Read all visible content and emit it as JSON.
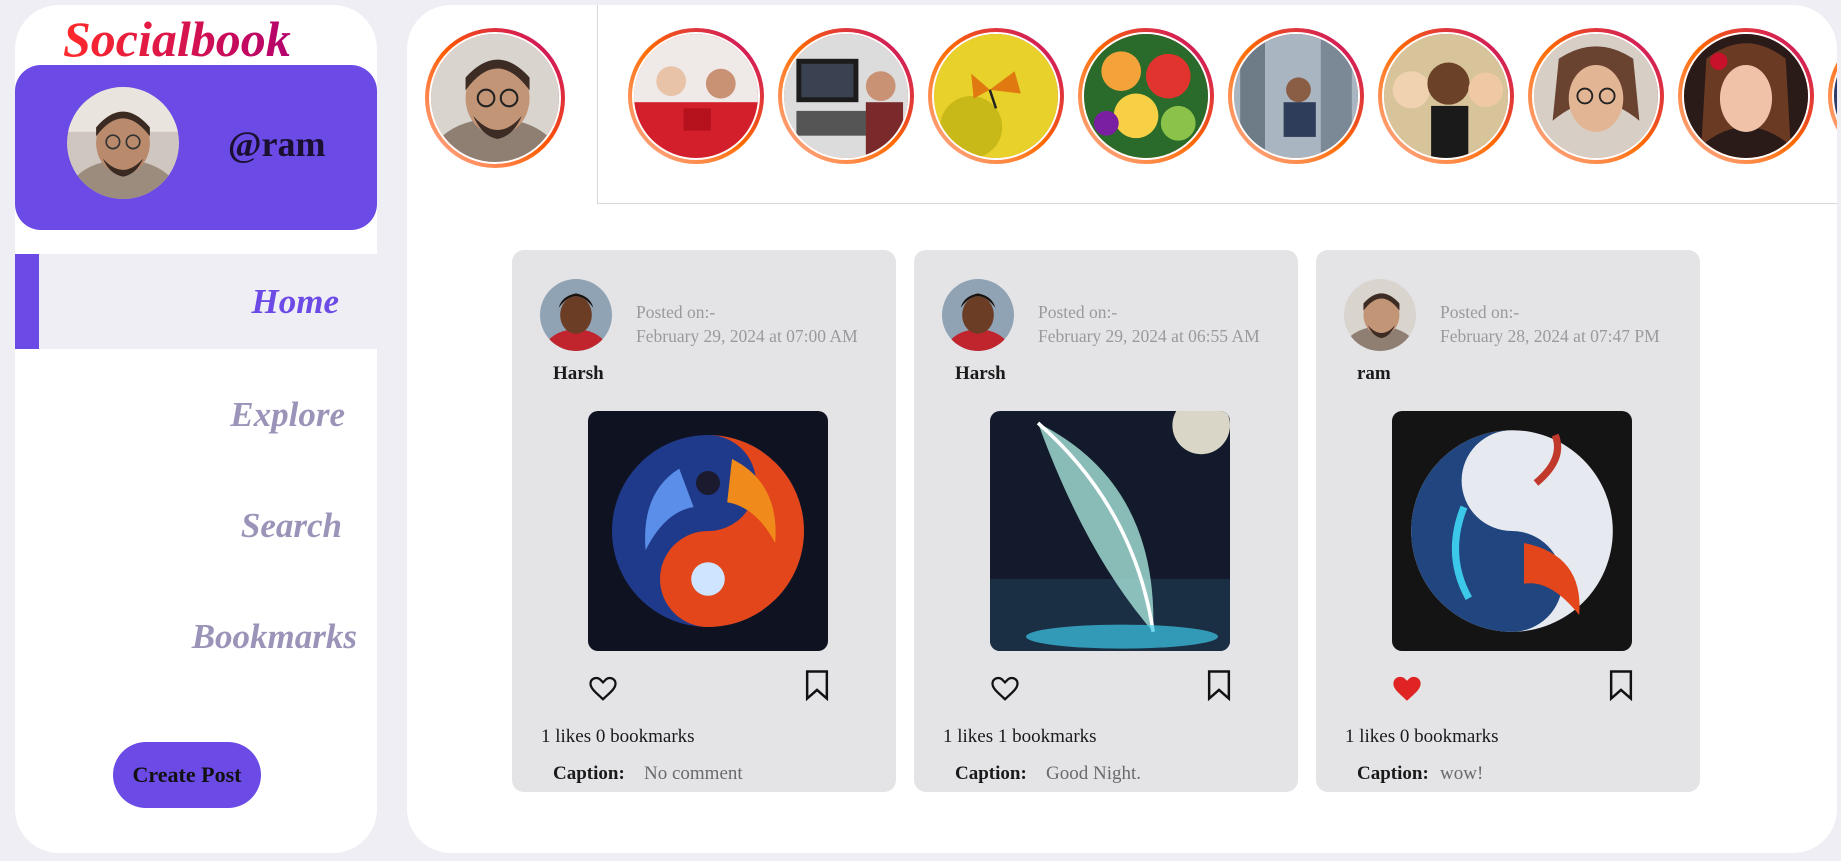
{
  "app": {
    "logo": "Socialbook"
  },
  "profile": {
    "handle": "@ram"
  },
  "nav": [
    {
      "label": "Home",
      "active": true
    },
    {
      "label": "Explore",
      "active": false
    },
    {
      "label": "Search",
      "active": false
    },
    {
      "label": "Bookmarks",
      "active": false
    }
  ],
  "create_post_label": "Create Post",
  "posts": [
    {
      "posted_label": "Posted on:-",
      "posted_date": "February 29, 2024 at 07:00 AM",
      "author": "Harsh",
      "stats": "1 likes 0 bookmarks",
      "caption_label": "Caption:",
      "caption": "No comment",
      "liked": false,
      "image": "phoenix-yin-yang"
    },
    {
      "posted_label": "Posted on:-",
      "posted_date": "February 29, 2024 at 06:55 AM",
      "author": "Harsh",
      "stats": "1 likes 1 bookmarks",
      "caption_label": "Caption:",
      "caption": "Good Night.",
      "liked": false,
      "image": "glowing-feather-moon"
    },
    {
      "posted_label": "Posted on:-",
      "posted_date": "February 28, 2024 at 07:47 PM",
      "author": "ram",
      "stats": "1 likes 0 bookmarks",
      "caption_label": "Caption:",
      "caption": "wow!",
      "liked": true,
      "image": "phoenix-yin-yang-light"
    }
  ],
  "colors": {
    "accent": "#6c4ae6",
    "like_active": "#e02424",
    "card_bg": "#e4e4e7",
    "page_bg": "#efeef5"
  }
}
